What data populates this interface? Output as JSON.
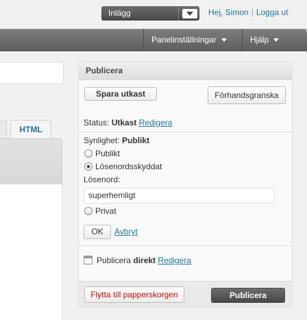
{
  "adminbar": {
    "favorites_label": "Inlägg",
    "howdy": "Hej, Simon",
    "separator": "|",
    "logout": "Logga ut"
  },
  "header": {
    "screen_options": "Panelinställningar",
    "help": "Hjälp"
  },
  "editor": {
    "tab_html": "HTML"
  },
  "publish": {
    "title": "Publicera",
    "save_draft": "Spara utkast",
    "preview": "Förhandsgranska",
    "status_label": "Status:",
    "status_value": "Utkast",
    "edit_link": "Redigera",
    "visibility_label": "Synlighet:",
    "visibility_value": "Publikt",
    "options": [
      {
        "label": "Publikt",
        "checked": false
      },
      {
        "label": "Lösenordsskyddat",
        "checked": true
      },
      {
        "label": "Privat",
        "checked": false
      }
    ],
    "password_label": "Lösenord:",
    "password_value": "superhemligt",
    "ok": "OK",
    "cancel": "Avbryt",
    "schedule_prefix": "Publicera",
    "schedule_value": "direkt",
    "schedule_edit": "Redigera",
    "trash": "Flytta till papperskorgen",
    "publish_button": "Publicera"
  }
}
